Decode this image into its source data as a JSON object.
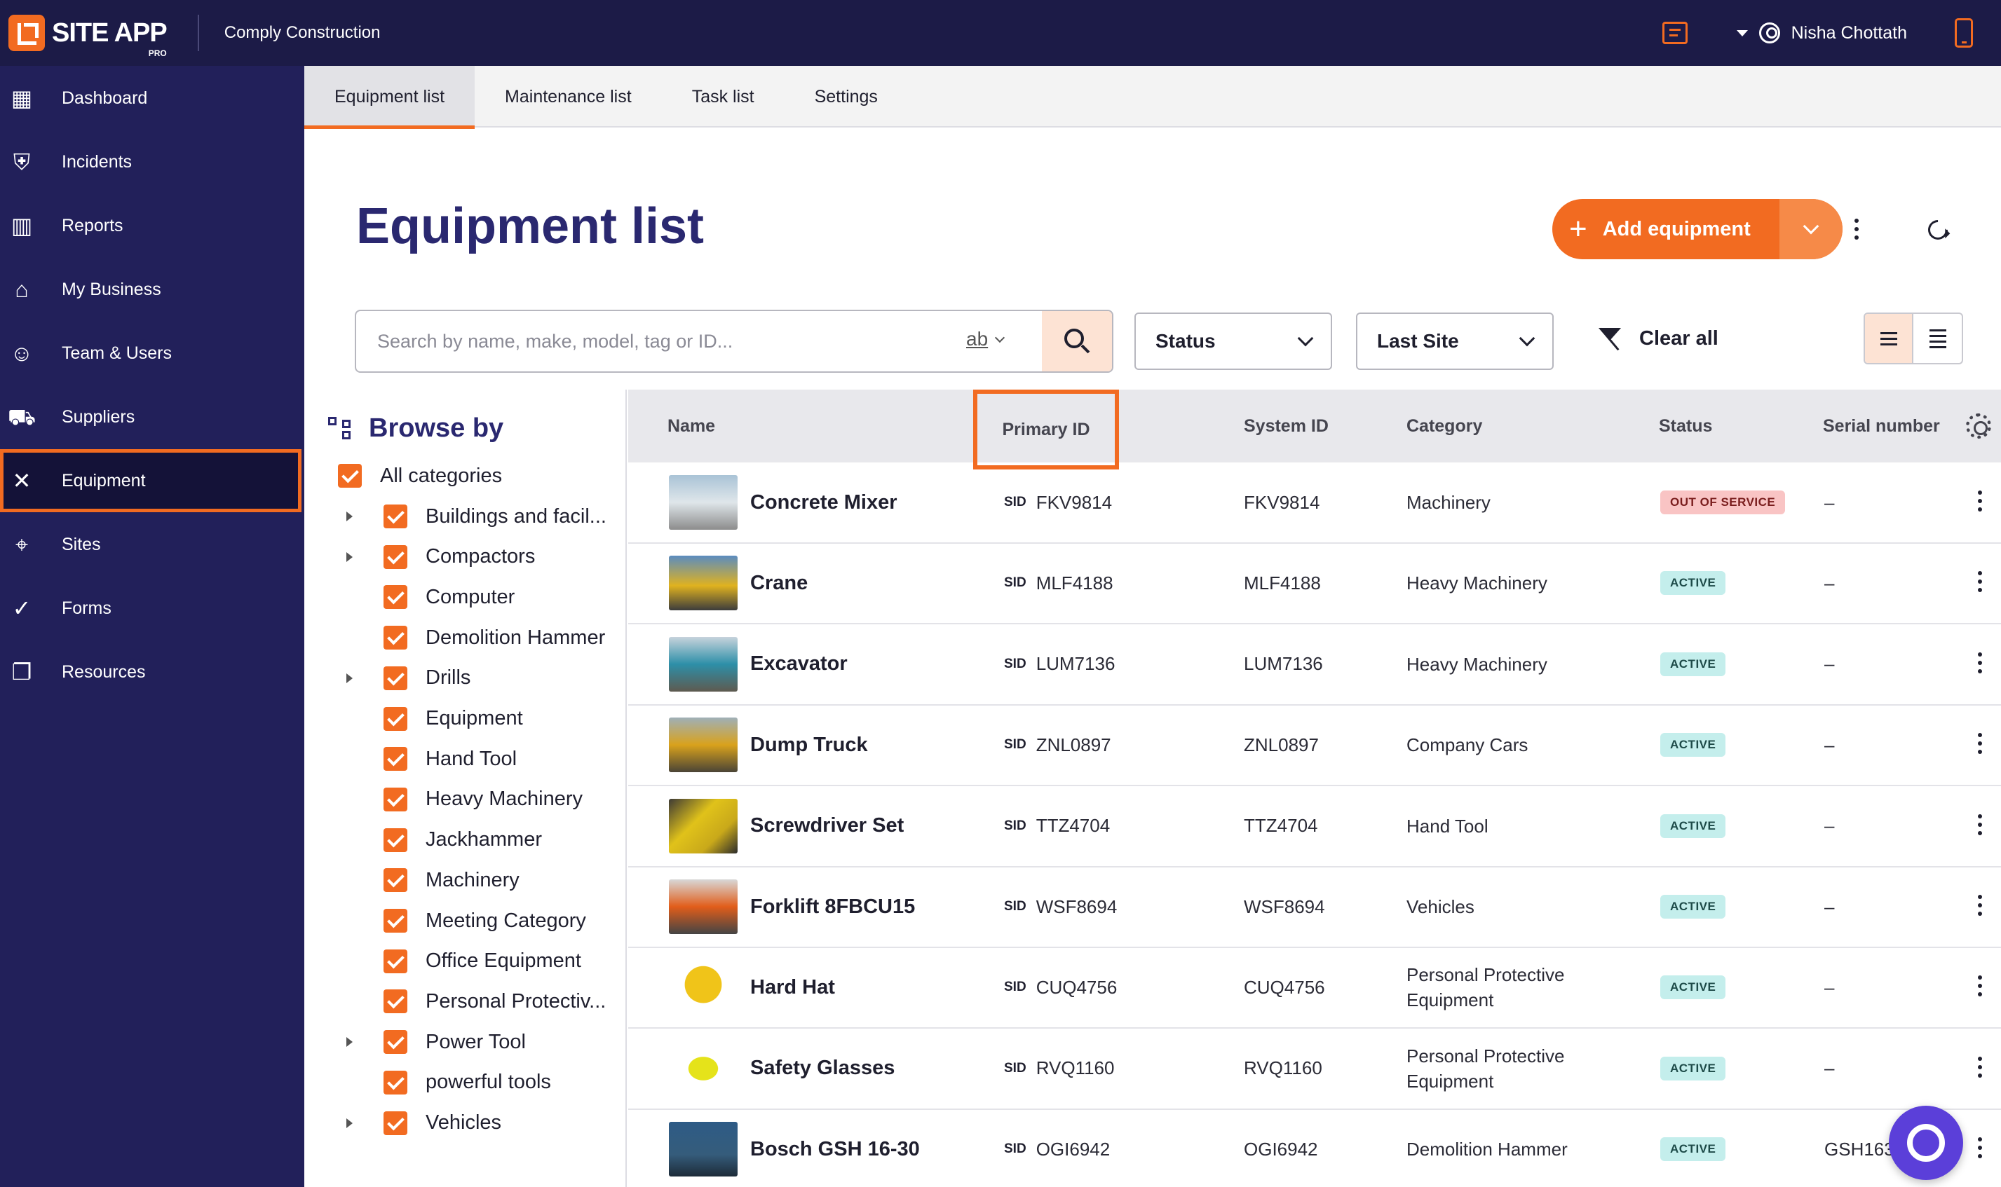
{
  "app": {
    "logo_text": "SITE APP",
    "logo_sub": "PRO",
    "org_name": "Comply Construction",
    "user_name": "Nisha Chottath",
    "accent_color": "#f26b21",
    "nav_bg": "#22205a"
  },
  "sidebar": {
    "items": [
      {
        "label": "Dashboard",
        "icon": "dashboard-icon"
      },
      {
        "label": "Incidents",
        "icon": "shield-plus-icon"
      },
      {
        "label": "Reports",
        "icon": "bar-chart-icon"
      },
      {
        "label": "My Business",
        "icon": "store-icon"
      },
      {
        "label": "Team & Users",
        "icon": "face-icon"
      },
      {
        "label": "Suppliers",
        "icon": "truck-icon"
      },
      {
        "label": "Equipment",
        "icon": "tools-icon",
        "active": true
      },
      {
        "label": "Sites",
        "icon": "location-pin-icon"
      },
      {
        "label": "Forms",
        "icon": "check-circle-icon"
      },
      {
        "label": "Resources",
        "icon": "copy-icon"
      }
    ]
  },
  "tabs": [
    {
      "label": "Equipment list",
      "active": true
    },
    {
      "label": "Maintenance list"
    },
    {
      "label": "Task list"
    },
    {
      "label": "Settings"
    }
  ],
  "header": {
    "title": "Equipment list",
    "add_button": "Add equipment"
  },
  "filters": {
    "search_placeholder": "Search by name, make, model, tag or ID...",
    "match_toggle": "ab",
    "status": "Status",
    "site": "Last Site",
    "clear": "Clear all"
  },
  "browse": {
    "title": "Browse by",
    "all": "All categories",
    "categories": [
      {
        "label": "Buildings and facil...",
        "expandable": true
      },
      {
        "label": "Compactors",
        "expandable": true
      },
      {
        "label": "Computer",
        "expandable": false
      },
      {
        "label": "Demolition Hammer",
        "expandable": false
      },
      {
        "label": "Drills",
        "expandable": true
      },
      {
        "label": "Equipment",
        "expandable": false
      },
      {
        "label": "Hand Tool",
        "expandable": false
      },
      {
        "label": "Heavy Machinery",
        "expandable": false
      },
      {
        "label": "Jackhammer",
        "expandable": false
      },
      {
        "label": "Machinery",
        "expandable": false
      },
      {
        "label": "Meeting Category",
        "expandable": false
      },
      {
        "label": "Office Equipment",
        "expandable": false
      },
      {
        "label": "Personal Protectiv...",
        "expandable": false
      },
      {
        "label": "Power Tool",
        "expandable": true
      },
      {
        "label": "powerful tools",
        "expandable": false
      },
      {
        "label": "Vehicles",
        "expandable": true
      }
    ]
  },
  "table": {
    "columns": {
      "name": "Name",
      "primary_id": "Primary ID",
      "system_id": "System ID",
      "category": "Category",
      "status": "Status",
      "serial": "Serial number"
    },
    "sid_label": "SID",
    "rows": [
      {
        "name": "Concrete Mixer",
        "primary_id": "FKV9814",
        "system_id": "FKV9814",
        "category": "Machinery",
        "status": "OUT OF SERVICE",
        "status_kind": "oos",
        "serial": "–"
      },
      {
        "name": "Crane",
        "primary_id": "MLF4188",
        "system_id": "MLF4188",
        "category": "Heavy Machinery",
        "status": "ACTIVE",
        "status_kind": "active",
        "serial": "–"
      },
      {
        "name": "Excavator",
        "primary_id": "LUM7136",
        "system_id": "LUM7136",
        "category": "Heavy Machinery",
        "status": "ACTIVE",
        "status_kind": "active",
        "serial": "–"
      },
      {
        "name": "Dump Truck",
        "primary_id": "ZNL0897",
        "system_id": "ZNL0897",
        "category": "Company Cars",
        "status": "ACTIVE",
        "status_kind": "active",
        "serial": "–"
      },
      {
        "name": "Screwdriver Set",
        "primary_id": "TTZ4704",
        "system_id": "TTZ4704",
        "category": "Hand Tool",
        "status": "ACTIVE",
        "status_kind": "active",
        "serial": "–"
      },
      {
        "name": "Forklift 8FBCU15",
        "primary_id": "WSF8694",
        "system_id": "WSF8694",
        "category": "Vehicles",
        "status": "ACTIVE",
        "status_kind": "active",
        "serial": "–"
      },
      {
        "name": "Hard Hat",
        "primary_id": "CUQ4756",
        "system_id": "CUQ4756",
        "category": "Personal Protective Equipment",
        "status": "ACTIVE",
        "status_kind": "active",
        "serial": "–"
      },
      {
        "name": "Safety Glasses",
        "primary_id": "RVQ1160",
        "system_id": "RVQ1160",
        "category": "Personal Protective Equipment",
        "status": "ACTIVE",
        "status_kind": "active",
        "serial": "–"
      },
      {
        "name": "Bosch GSH 16-30",
        "primary_id": "OGI6942",
        "system_id": "OGI6942",
        "category": "Demolition Hammer",
        "status": "ACTIVE",
        "status_kind": "active",
        "serial": "GSH163"
      }
    ]
  }
}
